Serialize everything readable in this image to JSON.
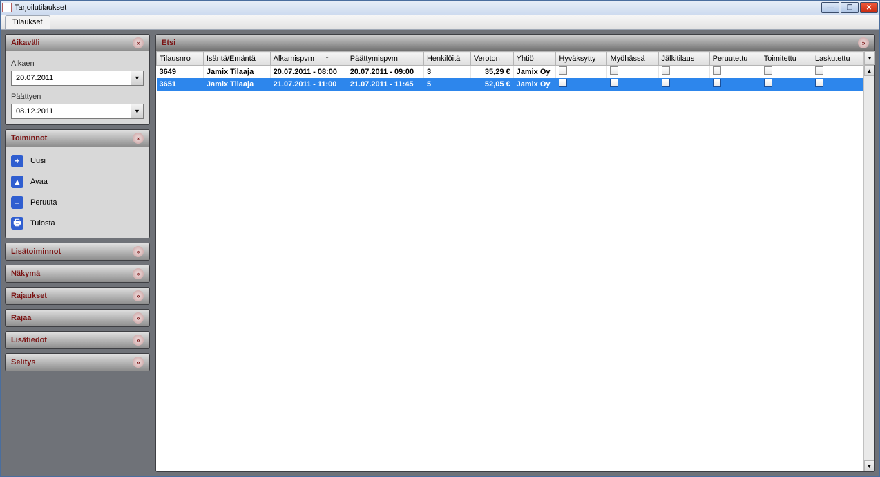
{
  "window": {
    "title": "Tarjoilutilaukset"
  },
  "tabs": [
    {
      "label": "Tilaukset"
    }
  ],
  "sidebar": {
    "aikavali": {
      "title": "Aikaväli",
      "from_label": "Alkaen",
      "from_value": "20.07.2011",
      "to_label": "Päättyen",
      "to_value": "08.12.2011"
    },
    "toiminnot": {
      "title": "Toiminnot",
      "items": [
        {
          "label": "Uusi"
        },
        {
          "label": "Avaa"
        },
        {
          "label": "Peruuta"
        },
        {
          "label": "Tulosta"
        }
      ]
    },
    "collapsed": [
      {
        "title": "Lisätoiminnot"
      },
      {
        "title": "Näkymä"
      },
      {
        "title": "Rajaukset"
      },
      {
        "title": "Rajaa"
      },
      {
        "title": "Lisätiedot"
      },
      {
        "title": "Selitys"
      }
    ]
  },
  "main": {
    "search_title": "Etsi",
    "columns": [
      "Tilausnro",
      "Isäntä/Emäntä",
      "Alkamispvm",
      "Päättymispvm",
      "Henkilöitä",
      "Veroton",
      "Yhtiö",
      "Hyväksytty",
      "Myöhässä",
      "Jälkitilaus",
      "Peruutettu",
      "Toimitettu",
      "Laskutettu"
    ],
    "rows": [
      {
        "tilausnro": "3649",
        "isanta": "Jamix Tilaaja",
        "alku": "20.07.2011 - 08:00",
        "loppu": "20.07.2011 - 09:00",
        "henkiloita": "3",
        "veroton": "35,29 €",
        "yhtio": "Jamix Oy"
      },
      {
        "tilausnro": "3651",
        "isanta": "Jamix Tilaaja",
        "alku": "21.07.2011 - 11:00",
        "loppu": "21.07.2011 - 11:45",
        "henkiloita": "5",
        "veroton": "52,05 €",
        "yhtio": "Jamix Oy"
      }
    ]
  }
}
